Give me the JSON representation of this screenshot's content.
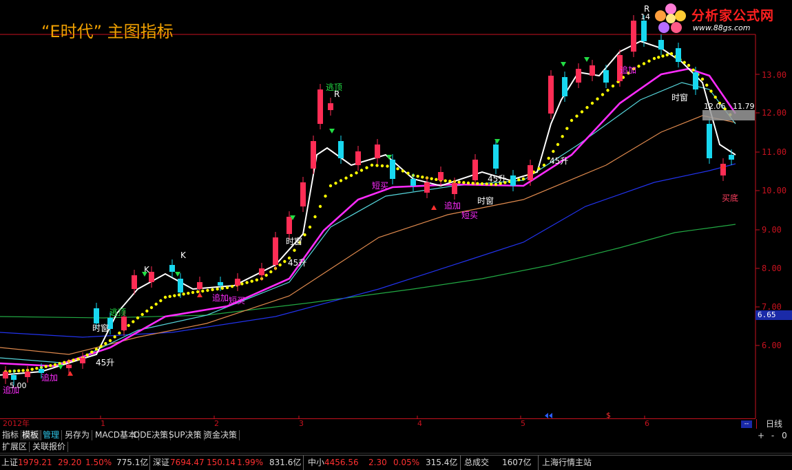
{
  "window": {
    "title": "“E时代” 主图指标",
    "logo_text": "分析家公式网",
    "logo_url": "www.88gs.com"
  },
  "price_axis": {
    "labels": [
      "13.00",
      "12.00",
      "11.00",
      "10.00",
      "9.00",
      "8.00",
      "7.00",
      "6.00"
    ],
    "current_price": "6.65"
  },
  "time_axis": {
    "labels": [
      "2012年",
      "1",
      "2",
      "3",
      "4",
      "5",
      "6"
    ],
    "period": "日线",
    "scroll_label": "--"
  },
  "tabs": [
    {
      "label": "指标"
    },
    {
      "label": "模板"
    },
    {
      "label": "管理"
    },
    {
      "label": "另存为"
    },
    {
      "label": "MACD基本"
    },
    {
      "label": "DDE决策"
    },
    {
      "label": "SUP决策"
    },
    {
      "label": "资金决策"
    }
  ],
  "controls": [
    "+",
    "-",
    "0"
  ],
  "tabs2": [
    {
      "label": "扩展区"
    },
    {
      "label": "关联报价"
    }
  ],
  "ticker": {
    "sh_label": "上证",
    "sh_value": "1979.21",
    "sh_change": "29.20",
    "sh_pct": "1.50%",
    "sh_amount": "775.1亿",
    "sz_label": "深证",
    "sz_value": "7694.47",
    "sz_change": "150.14",
    "sz_pct": "1.99%",
    "sz_amount": "831.6亿",
    "zx_label": "中小",
    "zx_value": "4456.56",
    "zx_change": "2.30",
    "zx_pct": "0.05%",
    "zx_amount": "315.4亿",
    "total_label": "总成交",
    "total_value": "1607亿",
    "station": "上海行情主站"
  },
  "annotations": {
    "escape_top": "逃顶",
    "time_window": "时窗",
    "add_buy": "追加",
    "short_buy": "短买",
    "buy_bottom": "买底",
    "rise_45": "45升",
    "mark_k": "K",
    "mark_r": "R",
    "label_500": "5.00",
    "label_1206": "12.06",
    "label_1179": "11.79",
    "label_14": "14",
    "dollar": "$"
  },
  "colors": {
    "up": "#ff2d55",
    "down": "#18d8f0",
    "dots": "#ffff00",
    "magenta": "#ff2cff",
    "white": "#ffffff",
    "cyan_line": "#56d6dc",
    "orange_line": "#e08a4e",
    "blue_line": "#2233ee",
    "green_line": "#22aa44",
    "axis": "#c8121f"
  }
}
